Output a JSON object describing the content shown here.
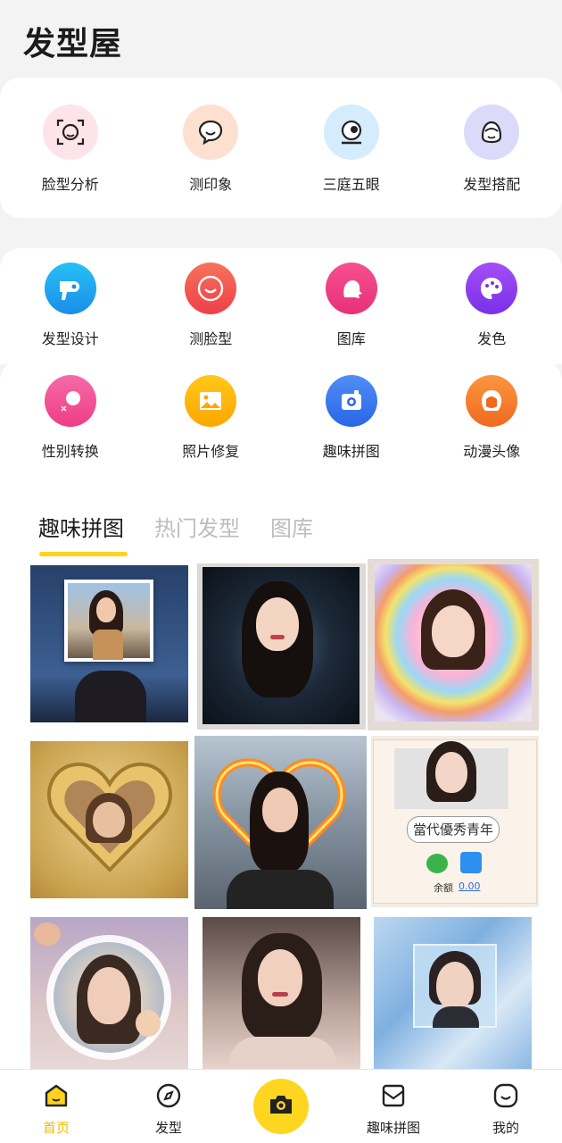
{
  "app": {
    "title": "发型屋"
  },
  "quick_actions": [
    {
      "label": "脸型分析",
      "icon": "face-scan-icon",
      "bg": "#fde4ea"
    },
    {
      "label": "测印象",
      "icon": "chat-bubble-icon",
      "bg": "#fde0cf"
    },
    {
      "label": "三庭五眼",
      "icon": "eye-camera-icon",
      "bg": "#d4ecfb"
    },
    {
      "label": "发型搭配",
      "icon": "hair-style-icon",
      "bg": "#dcdaf9"
    }
  ],
  "tools_row1": [
    {
      "label": "发型设计",
      "icon": "hair-dryer-icon",
      "bg": "#1ca6f0"
    },
    {
      "label": "测脸型",
      "icon": "smile-face-icon",
      "bg": "#f2564c"
    },
    {
      "label": "图库",
      "icon": "hair-gallery-icon",
      "bg": "#f03e86"
    },
    {
      "label": "发色",
      "icon": "palette-icon",
      "bg": "#8c3ff0"
    }
  ],
  "tools_row2": [
    {
      "label": "性别转换",
      "icon": "gender-switch-icon",
      "bg": "#f24c93"
    },
    {
      "label": "照片修复",
      "icon": "photo-icon",
      "bg": "#ffb400"
    },
    {
      "label": "趣味拼图",
      "icon": "collage-camera-icon",
      "bg": "#3a7bf0"
    },
    {
      "label": "动漫头像",
      "icon": "anime-avatar-icon",
      "bg": "#f57a2c"
    }
  ],
  "tabs": [
    {
      "label": "趣味拼图",
      "active": true
    },
    {
      "label": "热门发型",
      "active": false
    },
    {
      "label": "图库",
      "active": false
    }
  ],
  "grid_tiles": [
    {
      "name": "sky-photo-frame"
    },
    {
      "name": "swirl-portrait"
    },
    {
      "name": "rainbow-glow-portrait"
    },
    {
      "name": "golden-heart-frame"
    },
    {
      "name": "fire-heart-frame"
    },
    {
      "name": "phone-screen-sticker",
      "sticker_text": "當代優秀青年",
      "balance_label": "余额",
      "balance_value": "0.00"
    },
    {
      "name": "lace-cupid-frame"
    },
    {
      "name": "soft-portrait"
    },
    {
      "name": "ice-cube-frame"
    }
  ],
  "bottom_nav": [
    {
      "label": "首页",
      "icon": "home-icon",
      "active": true
    },
    {
      "label": "发型",
      "icon": "compass-icon",
      "active": false
    },
    {
      "label": "",
      "icon": "camera-icon",
      "active": false
    },
    {
      "label": "趣味拼图",
      "icon": "collage-icon",
      "active": false
    },
    {
      "label": "我的",
      "icon": "profile-icon",
      "active": false
    }
  ],
  "colors": {
    "accent": "#ffd21c",
    "active_nav": "#f5b800"
  }
}
